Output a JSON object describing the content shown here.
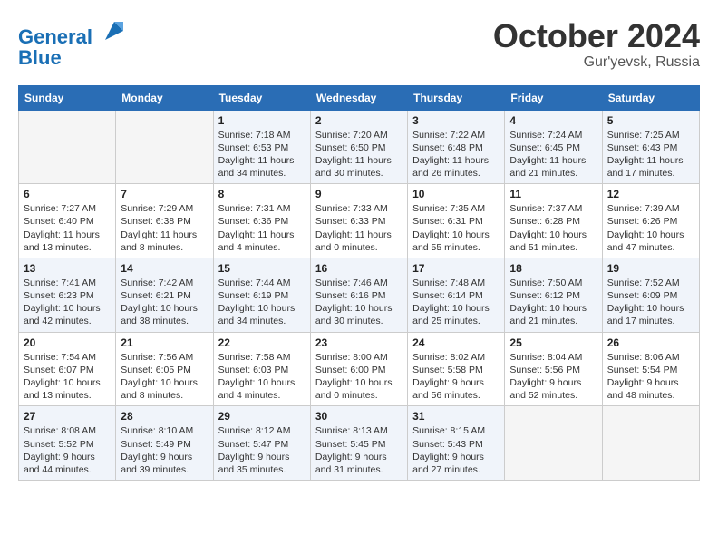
{
  "header": {
    "logo_line1": "General",
    "logo_line2": "Blue",
    "month": "October 2024",
    "location": "Gur'yevsk, Russia"
  },
  "days_of_week": [
    "Sunday",
    "Monday",
    "Tuesday",
    "Wednesday",
    "Thursday",
    "Friday",
    "Saturday"
  ],
  "weeks": [
    [
      {
        "num": "",
        "info": ""
      },
      {
        "num": "",
        "info": ""
      },
      {
        "num": "1",
        "info": "Sunrise: 7:18 AM\nSunset: 6:53 PM\nDaylight: 11 hours and 34 minutes."
      },
      {
        "num": "2",
        "info": "Sunrise: 7:20 AM\nSunset: 6:50 PM\nDaylight: 11 hours and 30 minutes."
      },
      {
        "num": "3",
        "info": "Sunrise: 7:22 AM\nSunset: 6:48 PM\nDaylight: 11 hours and 26 minutes."
      },
      {
        "num": "4",
        "info": "Sunrise: 7:24 AM\nSunset: 6:45 PM\nDaylight: 11 hours and 21 minutes."
      },
      {
        "num": "5",
        "info": "Sunrise: 7:25 AM\nSunset: 6:43 PM\nDaylight: 11 hours and 17 minutes."
      }
    ],
    [
      {
        "num": "6",
        "info": "Sunrise: 7:27 AM\nSunset: 6:40 PM\nDaylight: 11 hours and 13 minutes."
      },
      {
        "num": "7",
        "info": "Sunrise: 7:29 AM\nSunset: 6:38 PM\nDaylight: 11 hours and 8 minutes."
      },
      {
        "num": "8",
        "info": "Sunrise: 7:31 AM\nSunset: 6:36 PM\nDaylight: 11 hours and 4 minutes."
      },
      {
        "num": "9",
        "info": "Sunrise: 7:33 AM\nSunset: 6:33 PM\nDaylight: 11 hours and 0 minutes."
      },
      {
        "num": "10",
        "info": "Sunrise: 7:35 AM\nSunset: 6:31 PM\nDaylight: 10 hours and 55 minutes."
      },
      {
        "num": "11",
        "info": "Sunrise: 7:37 AM\nSunset: 6:28 PM\nDaylight: 10 hours and 51 minutes."
      },
      {
        "num": "12",
        "info": "Sunrise: 7:39 AM\nSunset: 6:26 PM\nDaylight: 10 hours and 47 minutes."
      }
    ],
    [
      {
        "num": "13",
        "info": "Sunrise: 7:41 AM\nSunset: 6:23 PM\nDaylight: 10 hours and 42 minutes."
      },
      {
        "num": "14",
        "info": "Sunrise: 7:42 AM\nSunset: 6:21 PM\nDaylight: 10 hours and 38 minutes."
      },
      {
        "num": "15",
        "info": "Sunrise: 7:44 AM\nSunset: 6:19 PM\nDaylight: 10 hours and 34 minutes."
      },
      {
        "num": "16",
        "info": "Sunrise: 7:46 AM\nSunset: 6:16 PM\nDaylight: 10 hours and 30 minutes."
      },
      {
        "num": "17",
        "info": "Sunrise: 7:48 AM\nSunset: 6:14 PM\nDaylight: 10 hours and 25 minutes."
      },
      {
        "num": "18",
        "info": "Sunrise: 7:50 AM\nSunset: 6:12 PM\nDaylight: 10 hours and 21 minutes."
      },
      {
        "num": "19",
        "info": "Sunrise: 7:52 AM\nSunset: 6:09 PM\nDaylight: 10 hours and 17 minutes."
      }
    ],
    [
      {
        "num": "20",
        "info": "Sunrise: 7:54 AM\nSunset: 6:07 PM\nDaylight: 10 hours and 13 minutes."
      },
      {
        "num": "21",
        "info": "Sunrise: 7:56 AM\nSunset: 6:05 PM\nDaylight: 10 hours and 8 minutes."
      },
      {
        "num": "22",
        "info": "Sunrise: 7:58 AM\nSunset: 6:03 PM\nDaylight: 10 hours and 4 minutes."
      },
      {
        "num": "23",
        "info": "Sunrise: 8:00 AM\nSunset: 6:00 PM\nDaylight: 10 hours and 0 minutes."
      },
      {
        "num": "24",
        "info": "Sunrise: 8:02 AM\nSunset: 5:58 PM\nDaylight: 9 hours and 56 minutes."
      },
      {
        "num": "25",
        "info": "Sunrise: 8:04 AM\nSunset: 5:56 PM\nDaylight: 9 hours and 52 minutes."
      },
      {
        "num": "26",
        "info": "Sunrise: 8:06 AM\nSunset: 5:54 PM\nDaylight: 9 hours and 48 minutes."
      }
    ],
    [
      {
        "num": "27",
        "info": "Sunrise: 8:08 AM\nSunset: 5:52 PM\nDaylight: 9 hours and 44 minutes."
      },
      {
        "num": "28",
        "info": "Sunrise: 8:10 AM\nSunset: 5:49 PM\nDaylight: 9 hours and 39 minutes."
      },
      {
        "num": "29",
        "info": "Sunrise: 8:12 AM\nSunset: 5:47 PM\nDaylight: 9 hours and 35 minutes."
      },
      {
        "num": "30",
        "info": "Sunrise: 8:13 AM\nSunset: 5:45 PM\nDaylight: 9 hours and 31 minutes."
      },
      {
        "num": "31",
        "info": "Sunrise: 8:15 AM\nSunset: 5:43 PM\nDaylight: 9 hours and 27 minutes."
      },
      {
        "num": "",
        "info": ""
      },
      {
        "num": "",
        "info": ""
      }
    ]
  ]
}
